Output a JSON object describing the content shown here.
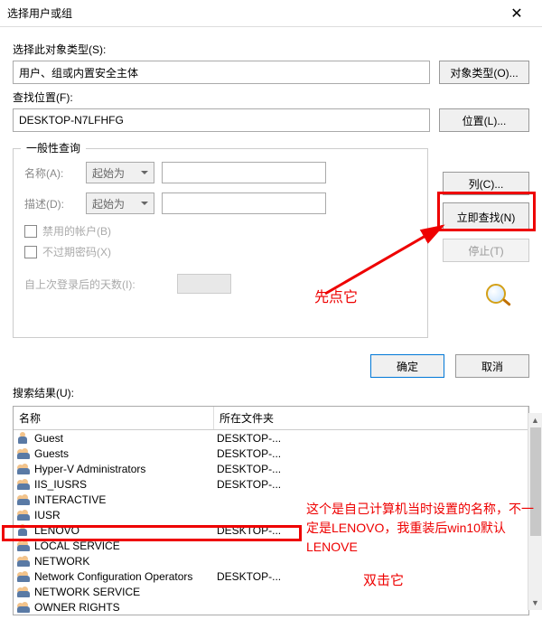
{
  "window": {
    "title": "选择用户或组"
  },
  "labels": {
    "object_type": "选择此对象类型(S):",
    "object_type_btn": "对象类型(O)...",
    "location": "查找位置(F):",
    "location_btn": "位置(L)...",
    "groupbox": "一般性查询",
    "name": "名称(A):",
    "desc": "描述(D):",
    "starts_with": "起始为",
    "cb_disabled": "禁用的帐户(B)",
    "cb_noexpire": "不过期密码(X)",
    "days_since": "自上次登录后的天数(I):",
    "btn_columns": "列(C)...",
    "btn_findnow": "立即查找(N)",
    "btn_stop": "停止(T)",
    "btn_ok": "确定",
    "btn_cancel": "取消",
    "results": "搜索结果(U):"
  },
  "values": {
    "object_type": "用户、组或内置安全主体",
    "location": "DESKTOP-N7LFHFG"
  },
  "columns": {
    "name": "名称",
    "folder": "所在文件夹"
  },
  "results": [
    {
      "type": "user",
      "name": "Guest",
      "folder": "DESKTOP-..."
    },
    {
      "type": "group",
      "name": "Guests",
      "folder": "DESKTOP-..."
    },
    {
      "type": "group",
      "name": "Hyper-V Administrators",
      "folder": "DESKTOP-..."
    },
    {
      "type": "group",
      "name": "IIS_IUSRS",
      "folder": "DESKTOP-..."
    },
    {
      "type": "group",
      "name": "INTERACTIVE",
      "folder": ""
    },
    {
      "type": "group",
      "name": "IUSR",
      "folder": ""
    },
    {
      "type": "user",
      "name": "LENOVO",
      "folder": "DESKTOP-..."
    },
    {
      "type": "group",
      "name": "LOCAL SERVICE",
      "folder": ""
    },
    {
      "type": "group",
      "name": "NETWORK",
      "folder": ""
    },
    {
      "type": "group",
      "name": "Network Configuration Operators",
      "folder": "DESKTOP-..."
    },
    {
      "type": "group",
      "name": "NETWORK SERVICE",
      "folder": ""
    },
    {
      "type": "group",
      "name": "OWNER RIGHTS",
      "folder": ""
    }
  ],
  "annotations": {
    "click_first": "先点它",
    "explain": "这个是自己计算机当时设置的名称，不一定是LENOVO，我重装后win10默认LENOVE",
    "dblclick": "双击它"
  }
}
